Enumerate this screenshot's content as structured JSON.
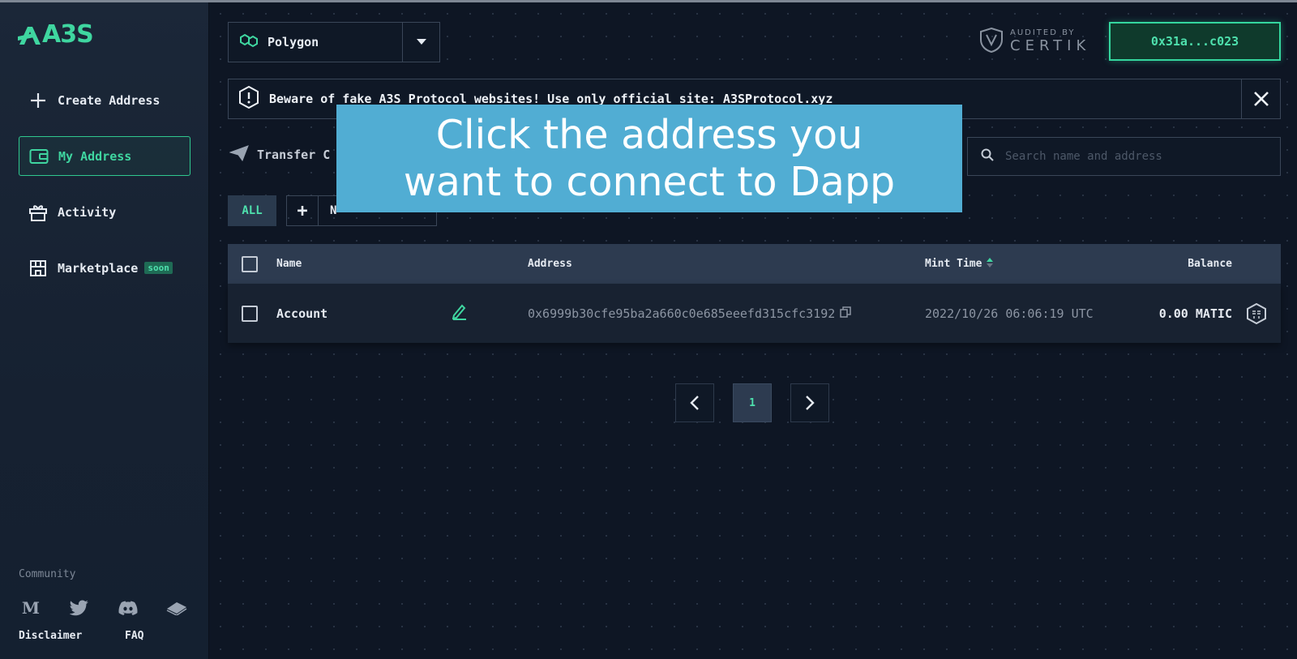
{
  "brand": {
    "logo_text": "A3S",
    "accent": "#3fd6a0"
  },
  "sidebar": {
    "items": [
      {
        "label": "Create Address",
        "icon": "plus-icon"
      },
      {
        "label": "My Address",
        "icon": "wallet-icon",
        "active": true
      },
      {
        "label": "Activity",
        "icon": "gift-icon"
      },
      {
        "label": "Marketplace",
        "icon": "store-icon",
        "badge": "soon"
      }
    ],
    "community_label": "Community",
    "social_icons": [
      "medium-icon",
      "twitter-icon",
      "discord-icon",
      "gitbook-icon"
    ],
    "social_medium": "M",
    "disclaimer_label": "Disclaimer",
    "faq_label": "FAQ"
  },
  "header": {
    "network": "Polygon",
    "audited_by": "AUDITED BY",
    "certik": "CERTIK",
    "wallet_address": "0x31a...c023"
  },
  "warning": {
    "text": "Beware of fake A3S Protocol websites! Use only official site: A3SProtocol.xyz"
  },
  "toolbar": {
    "transfer_label": "Transfer C",
    "search_placeholder": "Search name and address",
    "filter_all": "ALL",
    "filter_add": "+",
    "filter_new": "N"
  },
  "overlay": {
    "line1": "Click the address you",
    "line2": "want to connect to Dapp"
  },
  "table": {
    "headers": {
      "name": "Name",
      "address": "Address",
      "mint_time": "Mint Time",
      "balance": "Balance"
    },
    "rows": [
      {
        "name": "Account",
        "address": "0x6999b30cfe95ba2a660c0e685eeefd315cfc3192",
        "mint_time": "2022/10/26 06:06:19 UTC",
        "balance": "0.00 MATIC"
      }
    ]
  },
  "pagination": {
    "current": "1"
  }
}
